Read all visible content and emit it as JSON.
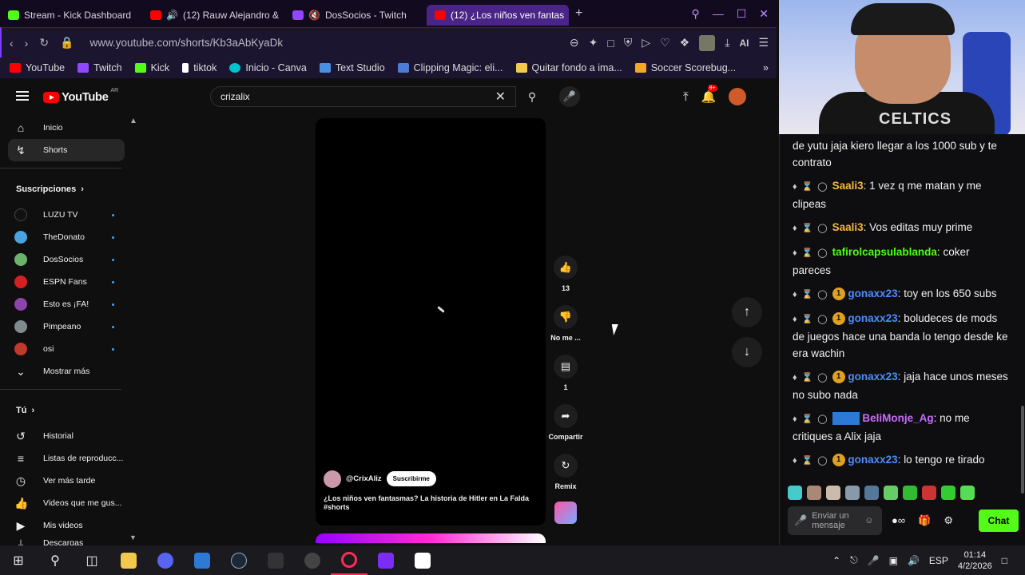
{
  "tabs": [
    {
      "label": "Stream - Kick Dashboard",
      "color": "#53fc18"
    },
    {
      "label": "(12) Rauw Alejandro &",
      "color": "#ff0000"
    },
    {
      "label": "DosSocios - Twitch",
      "color": "#9146ff"
    },
    {
      "label": "(12) ¿Los niños ven fantas",
      "color": "#ff0000",
      "active": true
    }
  ],
  "address": {
    "url": "www.youtube.com/shorts/Kb3aAbKyaDk",
    "ai_label": "AI"
  },
  "bookmarks": [
    {
      "label": "YouTube",
      "color": "#ff0000"
    },
    {
      "label": "Twitch",
      "color": "#9146ff"
    },
    {
      "label": "Kick",
      "color": "#53fc18"
    },
    {
      "label": "tiktok",
      "color": "#ffffff"
    },
    {
      "label": "Inicio - Canva",
      "color": "#00c4cc"
    },
    {
      "label": "Text Studio",
      "color": "#4a90e2"
    },
    {
      "label": "Clipping Magic: eli...",
      "color": "#4f7bd6"
    },
    {
      "label": "Quitar fondo a ima...",
      "color": "#f2c94c"
    },
    {
      "label": "Soccer Scorebug...",
      "color": "#f5a623"
    }
  ],
  "youtube": {
    "logo_word": "YouTube",
    "logo_country": "AR",
    "search_value": "crizalix",
    "notif_badge": "9+"
  },
  "sidebar": {
    "main": [
      {
        "label": "Inicio",
        "icon": "home-icon"
      },
      {
        "label": "Shorts",
        "icon": "shorts-icon",
        "selected": true
      }
    ],
    "subs_title": "Suscripciones",
    "subs": [
      {
        "label": "LUZU TV",
        "color": "#111"
      },
      {
        "label": "TheDonato",
        "color": "#4aa3df"
      },
      {
        "label": "DosSocios",
        "color": "#6bb36b"
      },
      {
        "label": "ESPN Fans",
        "color": "#d42121"
      },
      {
        "label": "Esto es ¡FA!",
        "color": "#8e44ad"
      },
      {
        "label": "Pimpeano",
        "color": "#7f8c8d"
      },
      {
        "label": "osi",
        "color": "#c0392b"
      }
    ],
    "show_more": "Mostrar más",
    "you_title": "Tú",
    "you": [
      {
        "label": "Historial",
        "icon": "history-icon"
      },
      {
        "label": "Listas de reproducc...",
        "icon": "playlist-icon"
      },
      {
        "label": "Ver más tarde",
        "icon": "clock-icon"
      },
      {
        "label": "Videos que me gus...",
        "icon": "like-icon"
      },
      {
        "label": "Mis videos",
        "icon": "video-icon"
      },
      {
        "label": "Descargas",
        "icon": "download-icon"
      }
    ]
  },
  "short": {
    "channel": "@CrixAliz",
    "subscribe": "Suscribirme",
    "caption": "¿Los niños ven fantasmas? La historia de Hitler en La Falda #shorts",
    "likes": "13",
    "dislike_label": "No me ...",
    "comments": "1",
    "share_label": "Compartir",
    "remix_label": "Remix"
  },
  "chat": {
    "messages": [
      {
        "user": "",
        "text": "de yutu jaja kiero llegar a los 1000 sub y te contrato",
        "color": "#ffffff",
        "cont": true
      },
      {
        "user": "Saali3",
        "text": "1 vez q me matan y me clipeas",
        "color": "#f5b841"
      },
      {
        "user": "Saali3",
        "text": "Vos editas muy prime",
        "color": "#f5b841"
      },
      {
        "user": "tafirolcapsulablanda",
        "text": "coker pareces",
        "color": "#53fc18"
      },
      {
        "user": "gonaxx23",
        "text": "toy en los 650 subs",
        "color": "#4f8cff",
        "sub": true
      },
      {
        "user": "gonaxx23",
        "text": "boludeces de mods de juegos hace una banda lo tengo desde ke era wachin",
        "color": "#4f8cff",
        "sub": true
      },
      {
        "user": "gonaxx23",
        "text": "jaja hace unos meses no subo nada",
        "color": "#4f8cff",
        "sub": true
      },
      {
        "user": "BeliMonje_Ag",
        "text": "no me critiques a Alix jaja",
        "color": "#c86bff",
        "square": true
      },
      {
        "user": "gonaxx23",
        "text": "lo tengo re tirado",
        "color": "#4f8cff",
        "sub": true
      }
    ],
    "input_placeholder": "Enviar un mensaje",
    "send_label": "Chat",
    "badge_one": "1"
  },
  "webcam": {
    "shirt_text": "CELTICS"
  },
  "taskbar": {
    "lang": "ESP",
    "time": "01:14",
    "date": "4/2/2026"
  }
}
